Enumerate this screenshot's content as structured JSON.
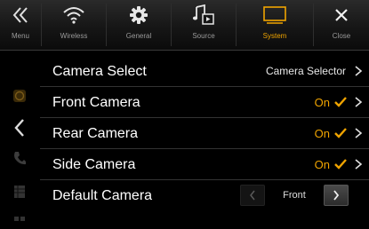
{
  "topbar": {
    "menu_label": "Menu",
    "tabs": [
      {
        "label": "Wireless",
        "icon": "wifi-icon"
      },
      {
        "label": "General",
        "icon": "gear-icon"
      },
      {
        "label": "Source",
        "icon": "music-source-icon"
      },
      {
        "label": "System",
        "icon": "monitor-icon",
        "active": true
      }
    ],
    "close_label": "Close"
  },
  "list": {
    "camera_select": {
      "label": "Camera Select",
      "value": "Camera Selector"
    },
    "front_camera": {
      "label": "Front Camera",
      "value": "On"
    },
    "rear_camera": {
      "label": "Rear Camera",
      "value": "On"
    },
    "side_camera": {
      "label": "Side Camera",
      "value": "On"
    },
    "default_camera": {
      "label": "Default Camera",
      "value": "Front"
    }
  },
  "colors": {
    "accent": "#f0a400",
    "background": "#000000",
    "divider": "#333333"
  }
}
